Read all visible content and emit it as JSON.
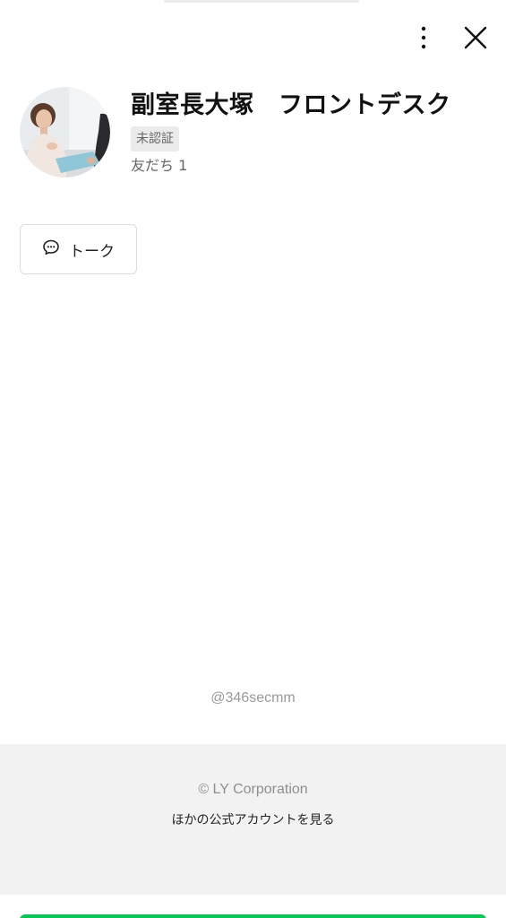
{
  "header": {
    "more_icon": "vertical-ellipsis",
    "close_icon": "close-x"
  },
  "profile": {
    "name": "副室長大塚　フロントデスク",
    "badge": "未認証",
    "friends": "友だち 1"
  },
  "actions": {
    "talk_label": "トーク",
    "talk_icon": "speech-bubble"
  },
  "account": {
    "handle": "@346secmm"
  },
  "footer": {
    "copyright": "© LY Corporation",
    "other_accounts_link": "ほかの公式アカウントを見る"
  },
  "colors": {
    "brand_green": "#06c755",
    "footer_bg": "#f2f2f2"
  }
}
